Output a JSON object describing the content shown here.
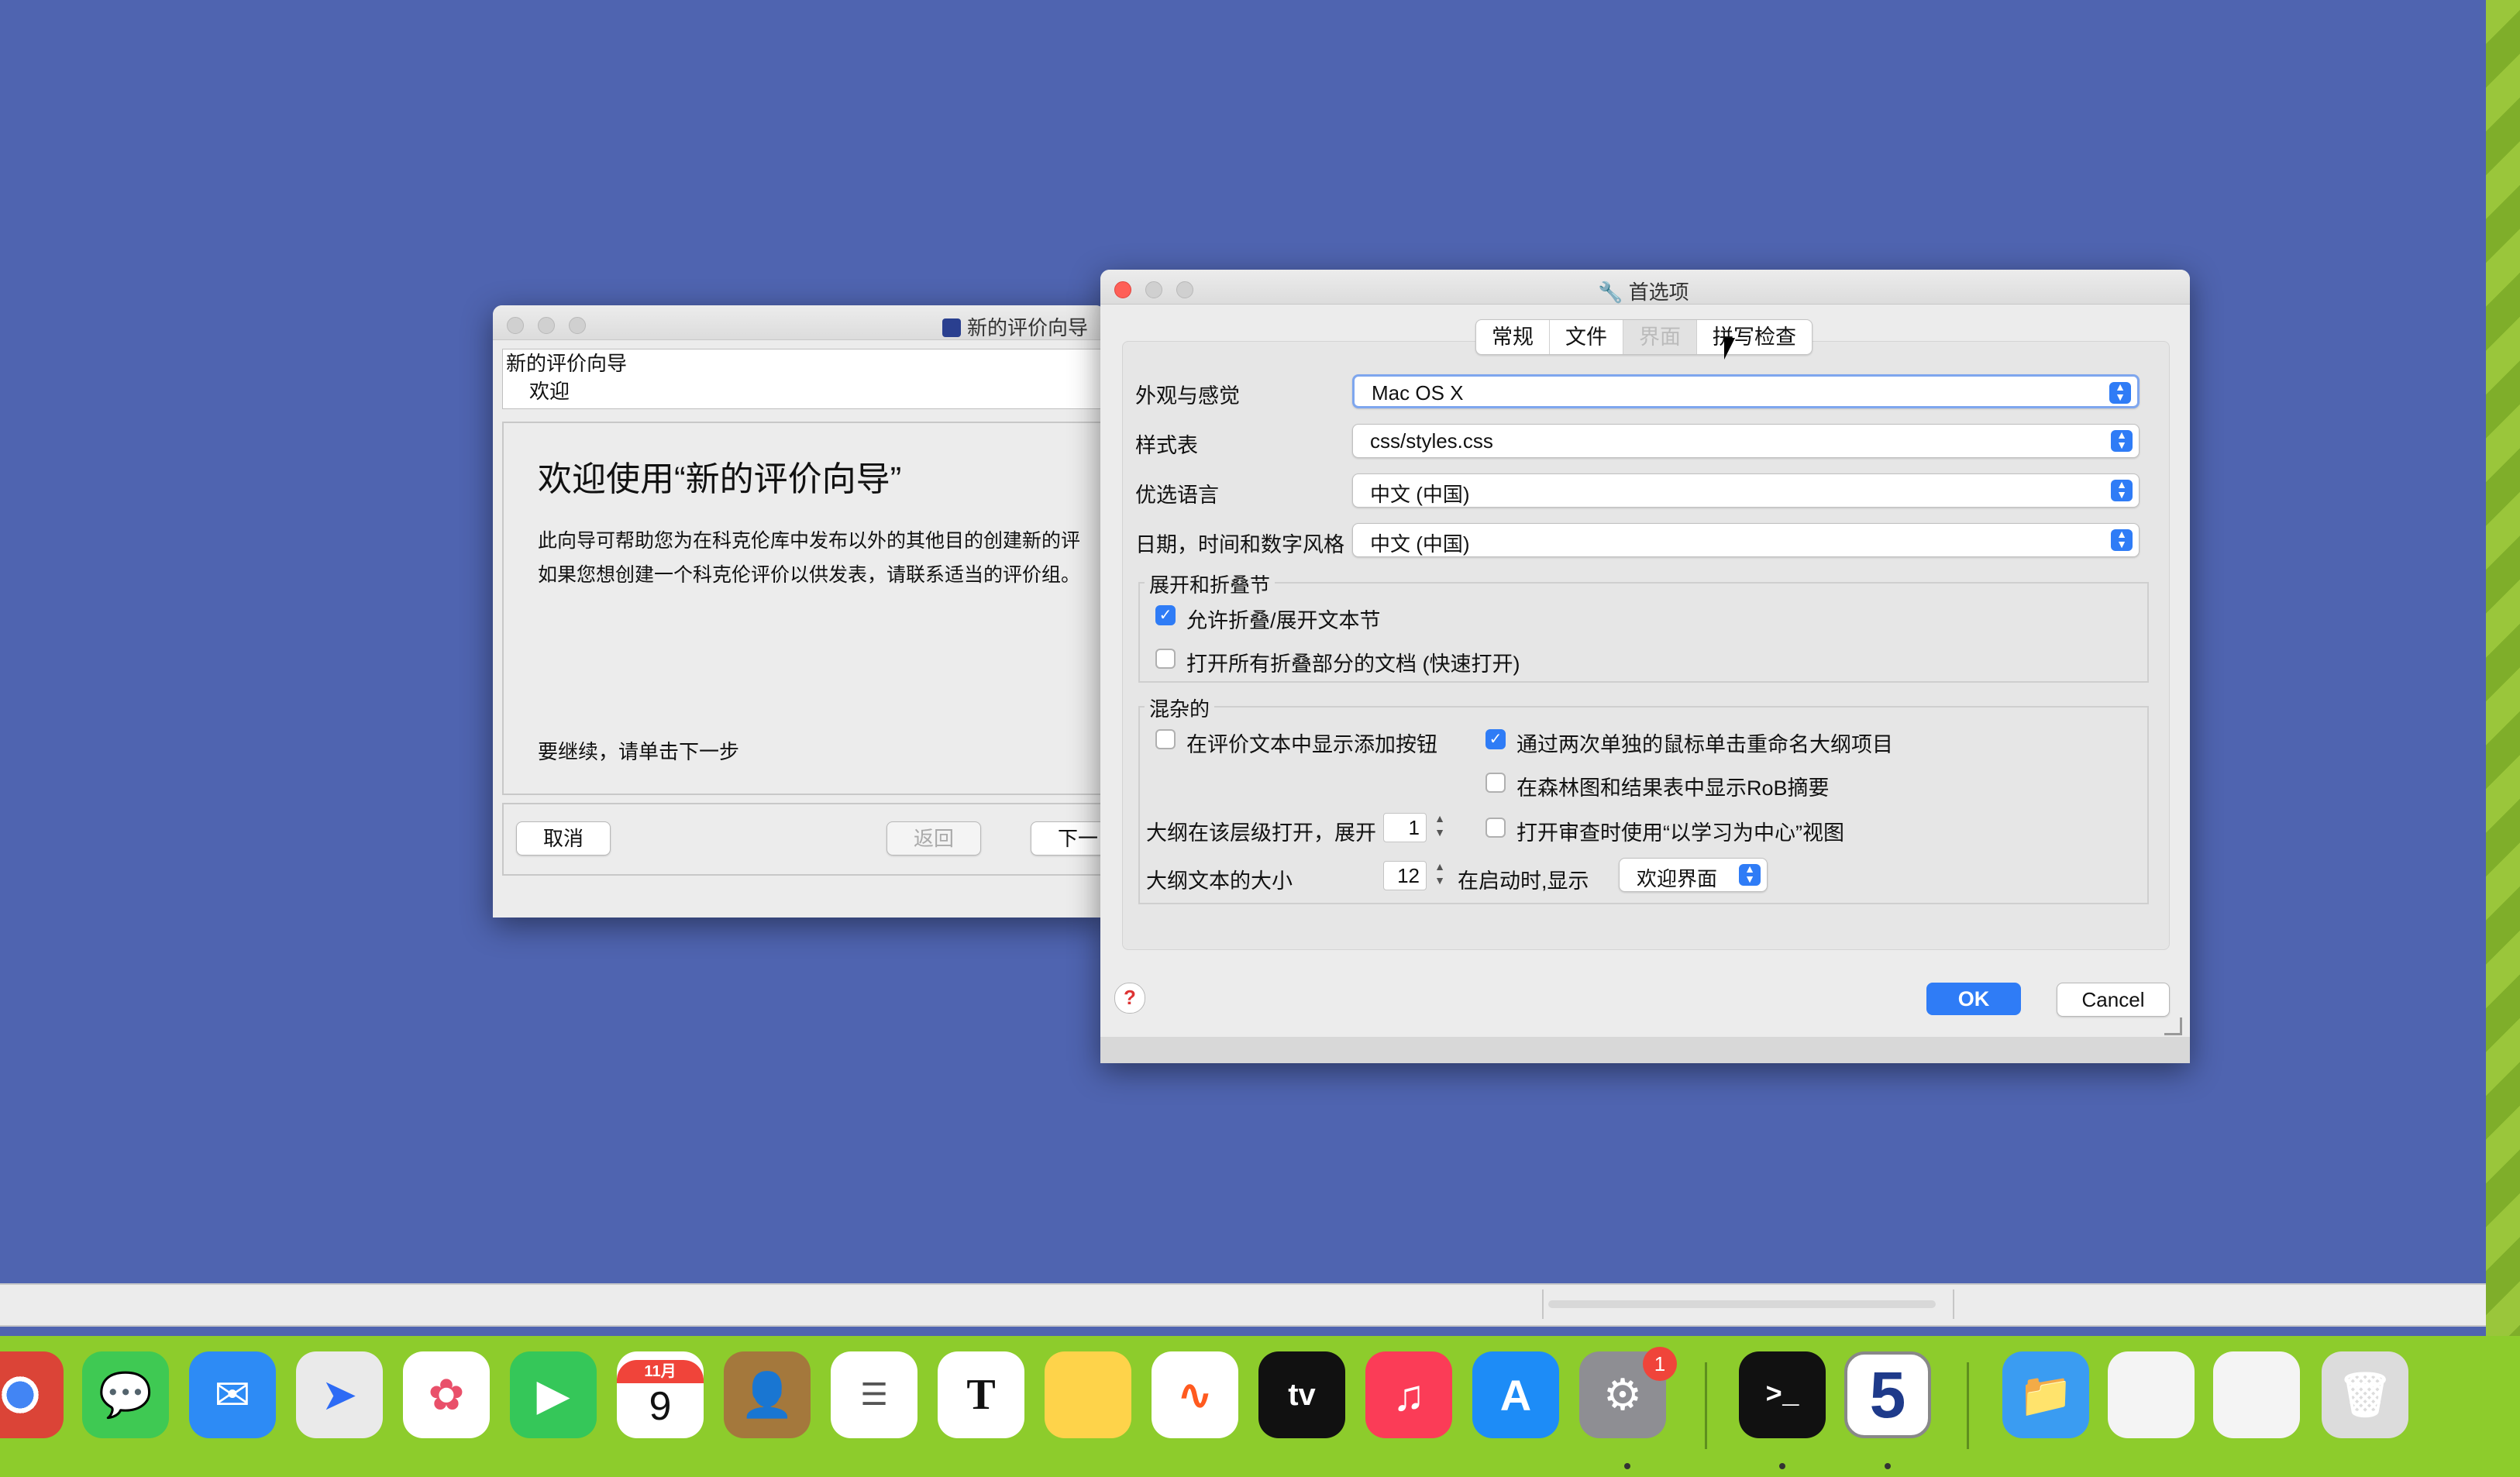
{
  "wizard": {
    "title": "新的评价向导",
    "tree": [
      "新的评价向导",
      "欢迎"
    ],
    "heading": "欢迎使用“新的评价向导”",
    "description": [
      "此向导可帮助您为在科克伦库中发布以外的其他目的创建新的评",
      "如果您想创建一个科克伦评价以供发表，请联系适当的评价组。"
    ],
    "continue_text": "要继续，请单击下一步",
    "cancel_label": "取消",
    "back_label": "返回",
    "next_label": "下一"
  },
  "prefs": {
    "title": "首选项",
    "tabs": [
      "常规",
      "文件",
      "界面",
      "拼写检查"
    ],
    "selected_tab": "界面",
    "look_feel_label": "外观与感觉",
    "look_feel_value": "Mac OS X",
    "stylesheet_label": "样式表",
    "stylesheet_value": "css/styles.css",
    "language_label": "优选语言",
    "language_value": "中文 (中国)",
    "datetime_label": "日期，时间和数字风格",
    "datetime_value": "中文 (中国)",
    "collapse_group": "展开和折叠节",
    "allow_collapse": {
      "label": "允许折叠/展开文本节",
      "checked": true
    },
    "open_all": {
      "label": "打开所有折叠部分的文档 (快速打开)",
      "checked": false
    },
    "misc_group": "混杂的",
    "show_add_button": {
      "label": "在评价文本中显示添加按钮",
      "checked": false
    },
    "rename_outline": {
      "label": "通过两次单独的鼠标单击重命名大纲项目",
      "checked": true
    },
    "show_rob": {
      "label": "在森林图和结果表中显示RoB摘要",
      "checked": false
    },
    "learning_view": {
      "label": "打开审查时使用“以学习为中心”视图",
      "checked": false
    },
    "outline_level_label": "大纲在该层级打开，展开",
    "outline_level_value": "1",
    "outline_size_label": "大纲文本的大小",
    "outline_size_value": "12",
    "startup_label": "在启动时,显示",
    "startup_value": "欢迎界面",
    "ok_label": "OK",
    "cancel_label": "Cancel",
    "help_symbol": "?"
  },
  "dock": {
    "calendar_month": "11月",
    "calendar_day": "9",
    "settings_badge": "1",
    "textedit_letter": "T",
    "tv_label": "tv",
    "terminal_prompt": ">_",
    "app5_label": "5"
  }
}
